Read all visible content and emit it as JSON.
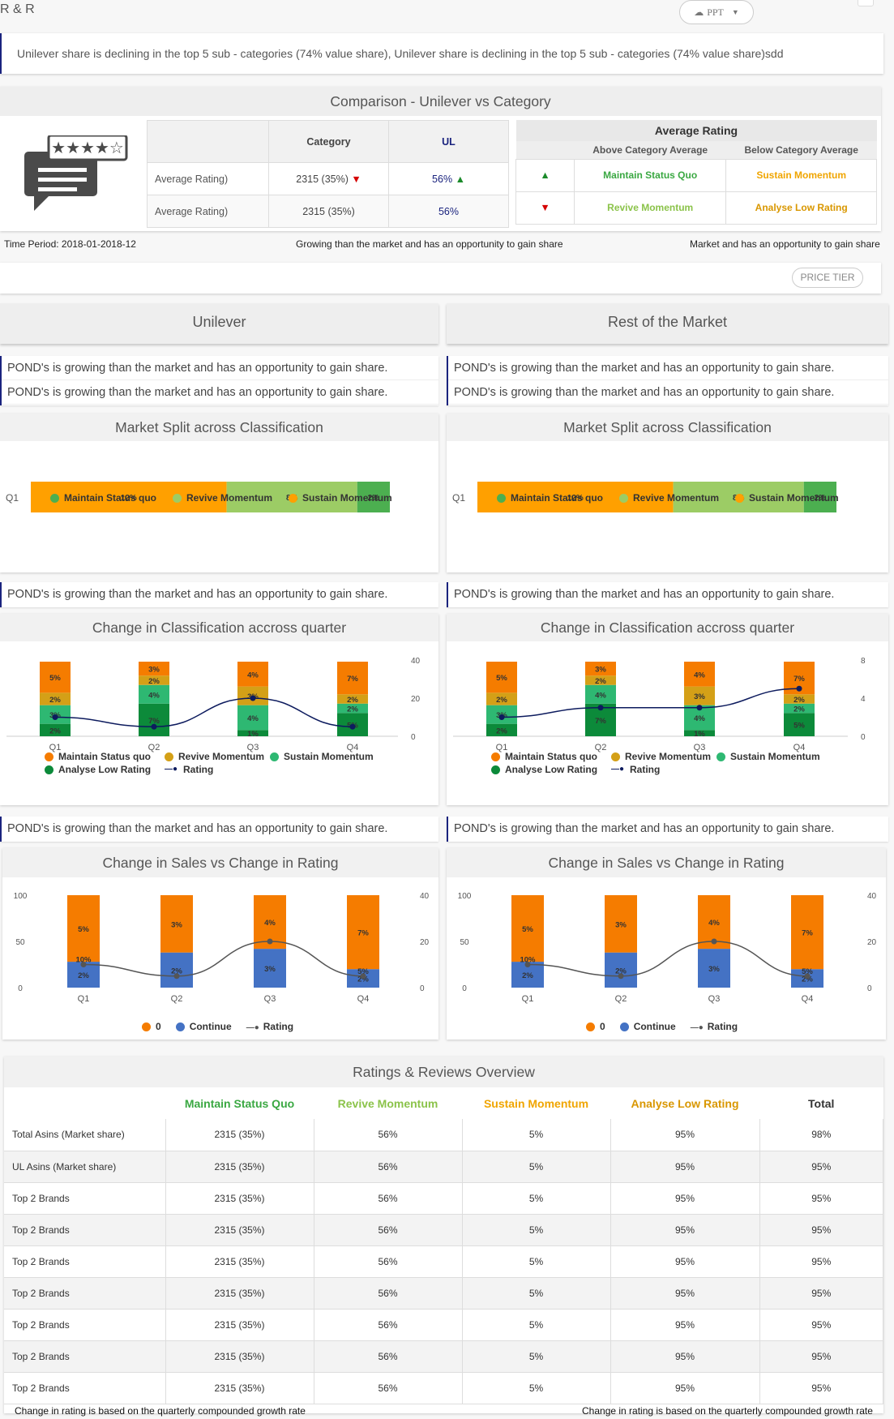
{
  "app": {
    "title": "R & R",
    "ppt_label": "PPT",
    "price_tier_label": "PRICE TIER"
  },
  "banner": "Unilever share is declining in the top 5 sub - categories (74% value share), Unilever share is declining in the top 5 sub - categories (74% value share)sdd",
  "comparison": {
    "title": "Comparison - Unilever vs Category",
    "col_category": "Category",
    "col_ul": "UL",
    "rows": [
      {
        "label": "Average Rating)",
        "category": "2315 (35%)",
        "ul": "56%"
      },
      {
        "label": "Average Rating)",
        "category": "2315 (35%)",
        "ul": "56%"
      }
    ],
    "avg_rating": {
      "title": "Average Rating",
      "above": "Above Category Average",
      "below": "Below Category Average",
      "maintain": "Maintain Status Quo",
      "sustain": "Sustain Momentum",
      "revive": "Revive Momentum",
      "analyse": "Analyse Low Rating"
    },
    "time_period": "Time Period: 2018-01-2018-12",
    "note_center": "Growing than the market and has an opportunity to gain share",
    "note_right": "Market and has an opportunity to gain share"
  },
  "panels": [
    {
      "title": "Unilever",
      "info_top": [
        "POND's is growing than the market and has an opportunity to gain share.",
        "POND's is growing than the market and has an opportunity to gain share."
      ],
      "split_title": "Market Split across Classification",
      "info_mid": "POND's is growing than the market and has an opportunity to gain share.",
      "change_title": "Change in Classification accross quarter",
      "info_bot": "POND's is growing than the market and has an opportunity to gain share.",
      "sales_title": "Change in Sales vs Change in Rating"
    },
    {
      "title": "Rest of the Market",
      "info_top": [
        "POND's is growing than the market and has an opportunity to gain share.",
        "POND's is growing than the market and has an opportunity to gain share."
      ],
      "split_title": "Market Split across Classification",
      "info_mid": "POND's is growing than the market and has an opportunity to gain share.",
      "change_title": "Change in Classification accross quarter",
      "info_bot": "POND's is growing than the market and has an opportunity to gain share.",
      "sales_title": "Change in Sales vs Change in Rating"
    }
  ],
  "colors": {
    "orange": "#f57c00",
    "amber": "#ffa000",
    "lightgreen": "#9ccc65",
    "green": "#4caf50",
    "mustard": "#d4a017",
    "teal": "#2eb872",
    "darkgreen": "#0c8a3a",
    "navy": "#0d1b5e",
    "blue": "#4472c4",
    "grey": "#555555"
  },
  "chart_data": [
    {
      "type": "bar",
      "title": "Market Split across Classification",
      "panel": "Unilever",
      "categories": [
        "Q1"
      ],
      "series": [
        {
          "name": "Sustain Momentum",
          "values": [
            12
          ]
        },
        {
          "name": "Revive Momentum",
          "values": [
            8
          ]
        },
        {
          "name": "Maintain Status quo",
          "values": [
            2
          ]
        }
      ],
      "legend": [
        "Maintain Status quo",
        "Revive Momentum",
        "Sustain Momentum"
      ]
    },
    {
      "type": "bar",
      "title": "Market Split across Classification",
      "panel": "Rest of the Market",
      "categories": [
        "Q1"
      ],
      "series": [
        {
          "name": "Sustain Momentum",
          "values": [
            12
          ]
        },
        {
          "name": "Revive Momentum",
          "values": [
            8
          ]
        },
        {
          "name": "Maintain Status quo",
          "values": [
            2
          ]
        }
      ],
      "legend": [
        "Maintain Status quo",
        "Revive Momentum",
        "Sustain Momentum"
      ]
    },
    {
      "type": "bar",
      "title": "Change in Classification accross quarter",
      "panel": "Unilever",
      "categories": [
        "Q1",
        "Q2",
        "Q3",
        "Q4"
      ],
      "series": [
        {
          "name": "Analyse Low Rating",
          "values": [
            2,
            7,
            1,
            5
          ]
        },
        {
          "name": "Sustain Momentum",
          "values": [
            3,
            4,
            4,
            2
          ]
        },
        {
          "name": "Revive Momentum",
          "values": [
            2,
            2,
            3,
            2
          ]
        },
        {
          "name": "Maintain Status quo",
          "values": [
            5,
            3,
            4,
            7
          ]
        }
      ],
      "line": {
        "name": "Rating",
        "values": [
          10,
          5,
          20,
          5
        ]
      },
      "yticks_right": [
        0,
        20,
        40
      ],
      "ylim_right": [
        0,
        40
      ],
      "legend": [
        "Maintain Status quo",
        "Revive Momentum",
        "Sustain Momentum",
        "Analyse Low Rating",
        "Rating"
      ]
    },
    {
      "type": "bar",
      "title": "Change in Classification accross quarter",
      "panel": "Rest of the Market",
      "categories": [
        "Q1",
        "Q2",
        "Q3",
        "Q4"
      ],
      "series": [
        {
          "name": "Analyse Low Rating",
          "values": [
            2,
            7,
            1,
            5
          ]
        },
        {
          "name": "Sustain Momentum",
          "values": [
            3,
            4,
            4,
            2
          ]
        },
        {
          "name": "Revive Momentum",
          "values": [
            2,
            2,
            3,
            2
          ]
        },
        {
          "name": "Maintain Status quo",
          "values": [
            5,
            3,
            4,
            7
          ]
        }
      ],
      "line": {
        "name": "Rating",
        "values": [
          2,
          3,
          3,
          5
        ]
      },
      "yticks_right": [
        0,
        4,
        8
      ],
      "ylim_right": [
        0,
        8
      ],
      "legend": [
        "Maintain Status quo",
        "Revive Momentum",
        "Sustain Momentum",
        "Analyse Low Rating",
        "Rating"
      ]
    },
    {
      "type": "bar",
      "title": "Change in Sales vs Change in Rating",
      "panel": "Unilever",
      "categories": [
        "Q1",
        "Q2",
        "Q3",
        "Q4"
      ],
      "series": [
        {
          "name": "Continue",
          "values": [
            28,
            38,
            42,
            20
          ],
          "labels": [
            "2%",
            "2%",
            "3%",
            "2%"
          ]
        },
        {
          "name": "0",
          "values": [
            72,
            62,
            58,
            80
          ],
          "labels": [
            "5%",
            "3%",
            "4%",
            "7%"
          ]
        }
      ],
      "line": {
        "name": "Rating",
        "values": [
          10,
          5,
          20,
          5
        ],
        "labels": [
          "10%",
          "",
          "",
          "5%"
        ]
      },
      "yticks_left": [
        "0",
        "50",
        "100"
      ],
      "yticks_right": [
        "0",
        "20",
        "40"
      ],
      "ylim_left": [
        0,
        100
      ],
      "ylim_right": [
        0,
        40
      ],
      "legend": [
        "0",
        "Continue",
        "Rating"
      ]
    },
    {
      "type": "bar",
      "title": "Change in Sales vs Change in Rating",
      "panel": "Rest of the Market",
      "categories": [
        "Q1",
        "Q2",
        "Q3",
        "Q4"
      ],
      "series": [
        {
          "name": "Continue",
          "values": [
            28,
            38,
            42,
            20
          ],
          "labels": [
            "2%",
            "2%",
            "3%",
            "2%"
          ]
        },
        {
          "name": "0",
          "values": [
            72,
            62,
            58,
            80
          ],
          "labels": [
            "5%",
            "3%",
            "4%",
            "7%"
          ]
        }
      ],
      "line": {
        "name": "Rating",
        "values": [
          10,
          5,
          20,
          5
        ],
        "labels": [
          "10%",
          "",
          "",
          "5%"
        ]
      },
      "yticks_left": [
        "0",
        "50",
        "100"
      ],
      "yticks_right": [
        "0",
        "20",
        "40"
      ],
      "ylim_left": [
        0,
        100
      ],
      "ylim_right": [
        0,
        40
      ],
      "legend": [
        "0",
        "Continue",
        "Rating"
      ]
    }
  ],
  "overview": {
    "title": "Ratings & Reviews Overview",
    "headers": [
      "",
      "Maintain Status Quo",
      "Revive Momentum",
      "Sustain Momentum",
      "Analyse Low Rating",
      "Total"
    ],
    "rows": [
      [
        "Total Asins (Market share)",
        "2315 (35%)",
        "56%",
        "5%",
        "95%",
        "98%"
      ],
      [
        "UL Asins (Market share)",
        "2315 (35%)",
        "56%",
        "5%",
        "95%",
        "95%"
      ],
      [
        "Top 2 Brands",
        "2315 (35%)",
        "56%",
        "5%",
        "95%",
        "95%"
      ],
      [
        "Top 2 Brands",
        "2315 (35%)",
        "56%",
        "5%",
        "95%",
        "95%"
      ],
      [
        "Top 2 Brands",
        "2315 (35%)",
        "56%",
        "5%",
        "95%",
        "95%"
      ],
      [
        "Top 2 Brands",
        "2315 (35%)",
        "56%",
        "5%",
        "95%",
        "95%"
      ],
      [
        "Top 2 Brands",
        "2315 (35%)",
        "56%",
        "5%",
        "95%",
        "95%"
      ],
      [
        "Top 2 Brands",
        "2315 (35%)",
        "56%",
        "5%",
        "95%",
        "95%"
      ],
      [
        "Top 2 Brands",
        "2315 (35%)",
        "56%",
        "5%",
        "95%",
        "95%"
      ]
    ],
    "footer_left": "Change in rating is based on the quarterly compounded growth rate",
    "footer_right": "Change in rating is based on the quarterly compounded growth rate"
  }
}
